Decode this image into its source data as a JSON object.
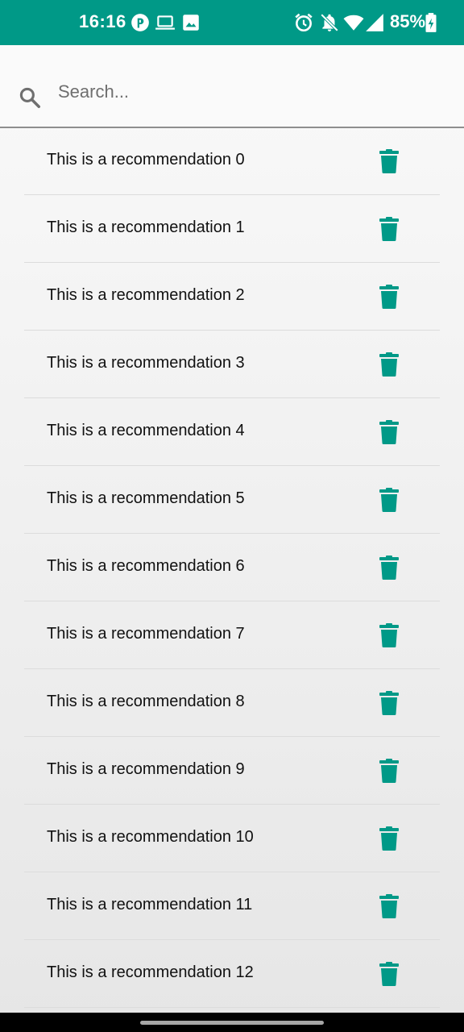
{
  "status_bar": {
    "time": "16:16",
    "battery": "85%",
    "background_color": "#009987",
    "left_icons": [
      "app-notification-icon",
      "laptop-icon",
      "image-icon"
    ],
    "right_icons": [
      "alarm-icon",
      "notifications-off-icon",
      "wifi-icon",
      "cellular-signal-icon",
      "battery-charging-icon"
    ]
  },
  "search": {
    "placeholder": "Search...",
    "value": "",
    "icon": "search-icon"
  },
  "recommendations": {
    "items": [
      {
        "label": "This is a recommendation 0"
      },
      {
        "label": "This is a recommendation 1"
      },
      {
        "label": "This is a recommendation 2"
      },
      {
        "label": "This is a recommendation 3"
      },
      {
        "label": "This is a recommendation 4"
      },
      {
        "label": "This is a recommendation 5"
      },
      {
        "label": "This is a recommendation 6"
      },
      {
        "label": "This is a recommendation 7"
      },
      {
        "label": "This is a recommendation 8"
      },
      {
        "label": "This is a recommendation 9"
      },
      {
        "label": "This is a recommendation 10"
      },
      {
        "label": "This is a recommendation 11"
      },
      {
        "label": "This is a recommendation 12"
      }
    ],
    "delete_icon": "trash-icon",
    "accent_color": "#009987"
  }
}
